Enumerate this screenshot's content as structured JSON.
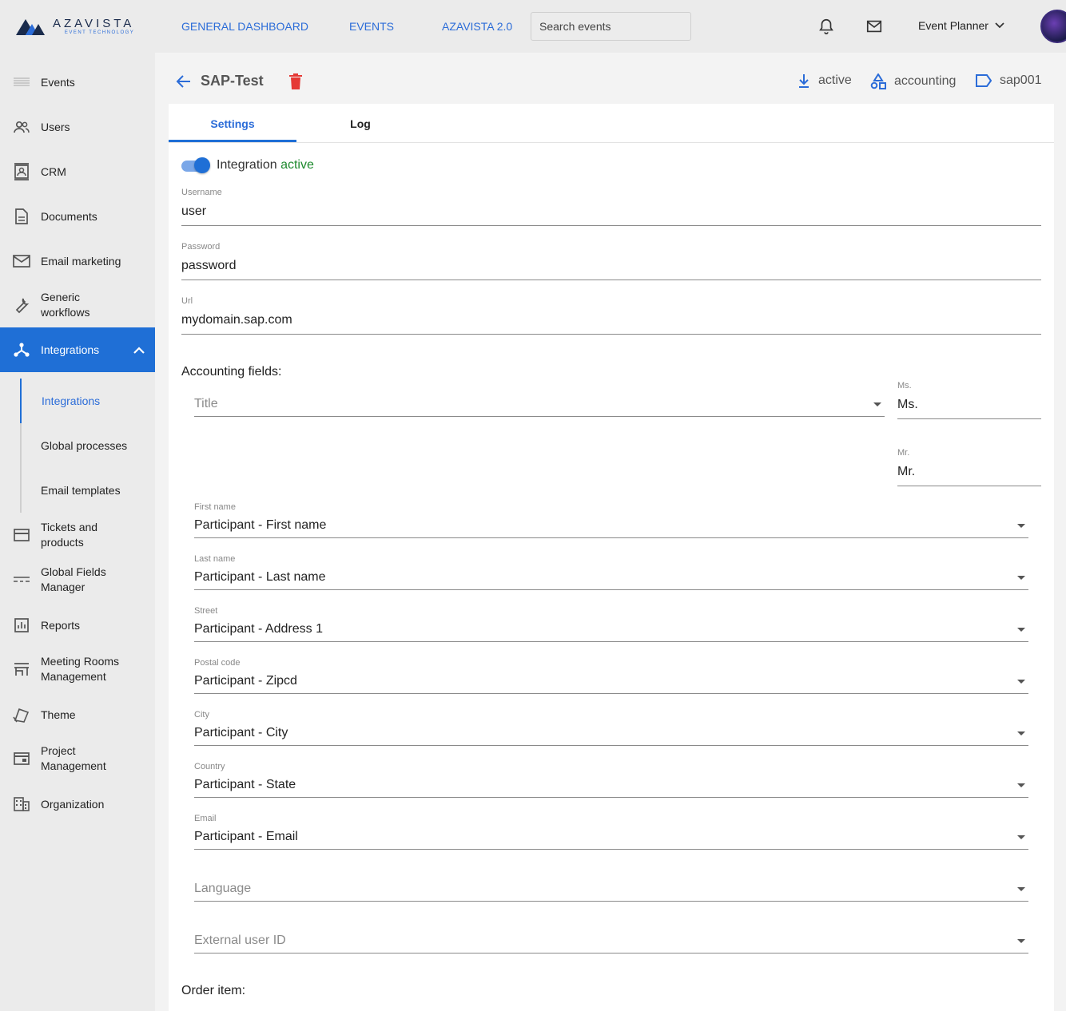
{
  "header": {
    "logo": {
      "name": "AZAVISTA",
      "tagline": "EVENT TECHNOLOGY"
    },
    "nav": [
      "GENERAL DASHBOARD",
      "EVENTS",
      "AZAVISTA 2.0"
    ],
    "search_placeholder": "Search events",
    "user": "Event Planner",
    "icons": [
      "bell-icon",
      "mail-icon",
      "chevron-down-icon"
    ]
  },
  "sidebar": {
    "items": [
      {
        "label": "Events",
        "icon": "events-icon"
      },
      {
        "label": "Users",
        "icon": "users-icon"
      },
      {
        "label": "CRM",
        "icon": "contact-card-icon"
      },
      {
        "label": "Documents",
        "icon": "document-icon"
      },
      {
        "label": "Email marketing",
        "icon": "mail-icon"
      },
      {
        "label": "Generic\nworkflows",
        "icon": "wrench-icon"
      },
      {
        "label": "Integrations",
        "icon": "integration-icon",
        "active": true
      }
    ],
    "sub_items": [
      "Integrations",
      "Global processes",
      "Email templates"
    ],
    "items_after": [
      {
        "label": "Tickets and products",
        "icon": "card-icon"
      },
      {
        "label": "Global Fields Manager",
        "icon": "fields-icon"
      },
      {
        "label": "Reports",
        "icon": "report-icon"
      },
      {
        "label": "Meeting Rooms Management",
        "icon": "store-icon"
      },
      {
        "label": "Theme",
        "icon": "theme-icon"
      },
      {
        "label": "Project Management",
        "icon": "project-icon"
      },
      {
        "label": "Organization",
        "icon": "building-icon"
      }
    ]
  },
  "page": {
    "title": "SAP-Test",
    "meta": {
      "status": "active",
      "type": "accounting",
      "code": "sap001"
    }
  },
  "tabs": [
    "Settings",
    "Log"
  ],
  "integration": {
    "toggle_text": "Integration",
    "toggle_state": "active",
    "username": {
      "label": "Username",
      "value": "user"
    },
    "password": {
      "label": "Password",
      "value": "password"
    },
    "url": {
      "label": "Url",
      "value": "mydomain.sap.com"
    }
  },
  "accounting": {
    "heading": "Accounting fields:",
    "title_select": "Title",
    "salutations": [
      {
        "label": "Ms.",
        "value": "Ms."
      },
      {
        "label": "Mr.",
        "value": "Mr."
      }
    ],
    "fields": [
      {
        "label": "First name",
        "value": "Participant - First name"
      },
      {
        "label": "Last name",
        "value": "Participant - Last name"
      },
      {
        "label": "Street",
        "value": "Participant - Address 1"
      },
      {
        "label": "Postal code",
        "value": "Participant - Zipcd"
      },
      {
        "label": "City",
        "value": "Participant - City"
      },
      {
        "label": "Country",
        "value": "Participant - State"
      },
      {
        "label": "Email",
        "value": "Participant - Email"
      }
    ],
    "empty_fields": [
      "Language",
      "External user ID"
    ]
  },
  "order": {
    "heading": "Order item:"
  }
}
